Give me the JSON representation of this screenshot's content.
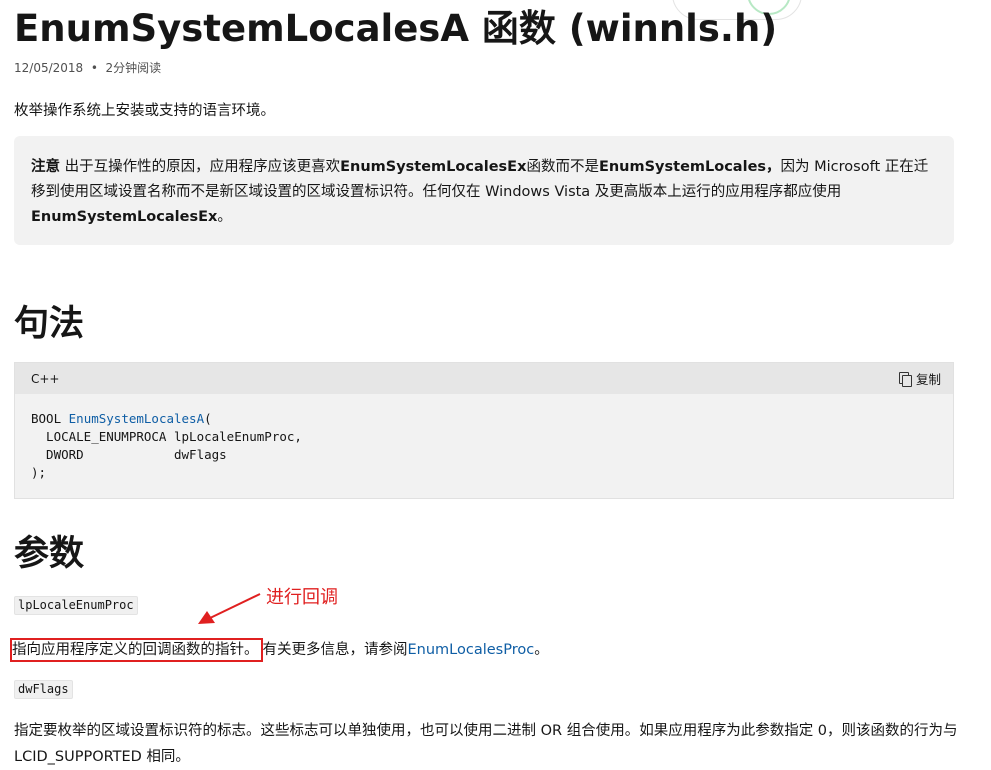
{
  "page": {
    "title": "EnumSystemLocalesA 函数 (winnls.h)",
    "date": "12/05/2018",
    "read_time": "2分钟阅读",
    "description": "枚举操作系统上安装或支持的语言环境。"
  },
  "note": {
    "label": "注意",
    "text_1": "出于互操作性的原因，应用程序应该更喜欢",
    "bold_1": "EnumSystemLocalesEx",
    "text_2": "函数而不是",
    "bold_2": "EnumSystemLocales，",
    "text_3": "因为 Microsoft 正在迁移到使用区域设置名称而不是新区域设置的区域设置标识符。任何仅在 Windows Vista 及更高版本上运行的应用程序都应使用",
    "bold_3": "EnumSystemLocalesEx",
    "text_4": "。"
  },
  "syntax": {
    "heading": "句法",
    "language": "C++",
    "copy_label": "复制",
    "line1_prefix": "BOOL ",
    "line1_fn": "EnumSystemLocalesA",
    "line1_suffix": "(",
    "line2": "  LOCALE_ENUMPROCA lpLocaleEnumProc,",
    "line3": "  DWORD            dwFlags",
    "line4": ");"
  },
  "parameters": {
    "heading": "参数",
    "param1": {
      "name": "lpLocaleEnumProc",
      "desc_highlighted": "指向应用程序定义的回调函数的指针。",
      "desc_rest": "有关更多信息，请参阅",
      "link": "EnumLocalesProc",
      "desc_end": "。"
    },
    "param2": {
      "name": "dwFlags",
      "desc": "指定要枚举的区域设置标识符的标志。这些标志可以单独使用，也可以使用二进制 OR 组合使用。如果应用程序为此参数指定 0，则该函数的行为与 LCID_SUPPORTED 相同。"
    }
  },
  "annotation": {
    "text": "进行回调",
    "color": "#e02020"
  },
  "colors": {
    "link": "#0f5ea5",
    "note_background": "#f2f2f2",
    "code_header": "#e6e6e6"
  }
}
